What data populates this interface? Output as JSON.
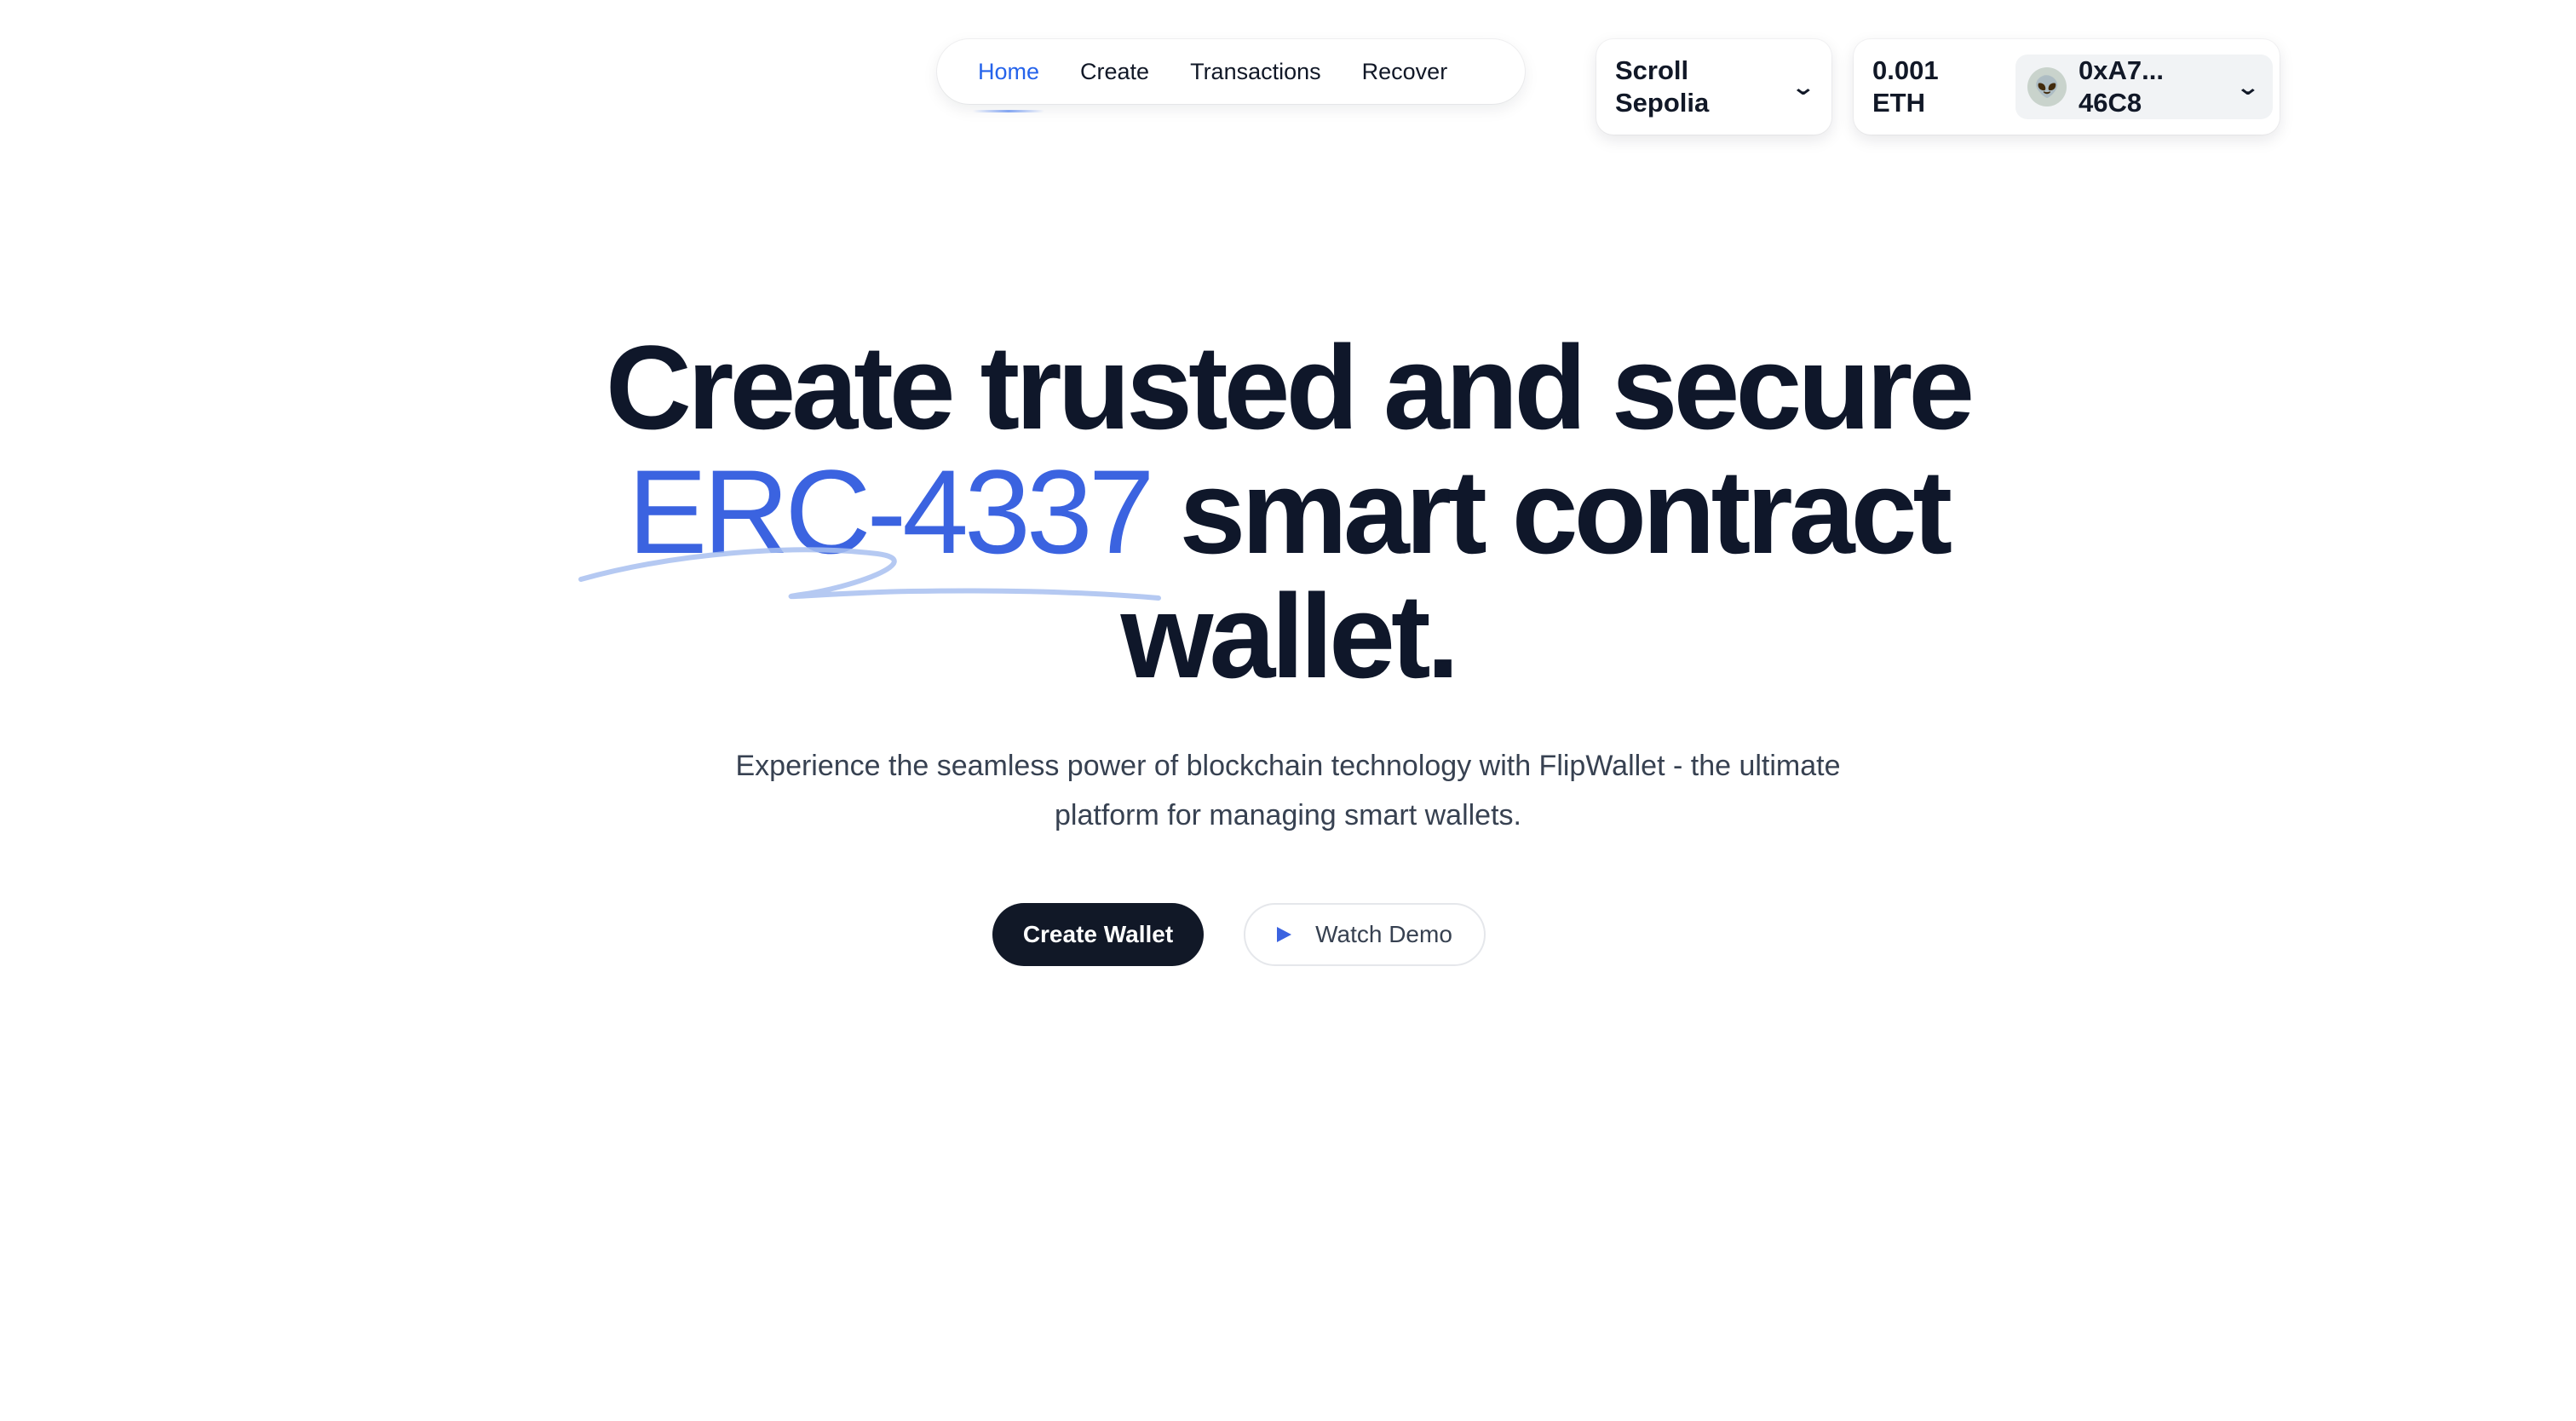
{
  "nav": {
    "items": [
      {
        "label": "Home",
        "active": true
      },
      {
        "label": "Create"
      },
      {
        "label": "Transactions"
      },
      {
        "label": "Recover"
      }
    ]
  },
  "network": {
    "line1": "Scroll",
    "line2": "Sepolia",
    "icon": "chevron-down-icon"
  },
  "account": {
    "balance_line1": "0.001",
    "balance_line2": "ETH",
    "address_line1": "0xA7...",
    "address_line2": "46C8",
    "avatar_glyph": "👽",
    "icon": "chevron-down-icon"
  },
  "hero": {
    "title_line1": "Create trusted and secure",
    "title_accent": "ERC-4337",
    "title_line2_rest": " smart contract",
    "title_line3": "wallet.",
    "subtitle_line1": "Experience the seamless power of blockchain technology with FlipWallet - the ultimate",
    "subtitle_line2": "platform for managing smart wallets."
  },
  "actions": {
    "primary_label": "Create Wallet",
    "secondary_label": "Watch Demo",
    "secondary_icon": "play-icon"
  },
  "colors": {
    "accent": "#3b63e0",
    "text": "#0f172a",
    "button_dark": "#111827"
  }
}
